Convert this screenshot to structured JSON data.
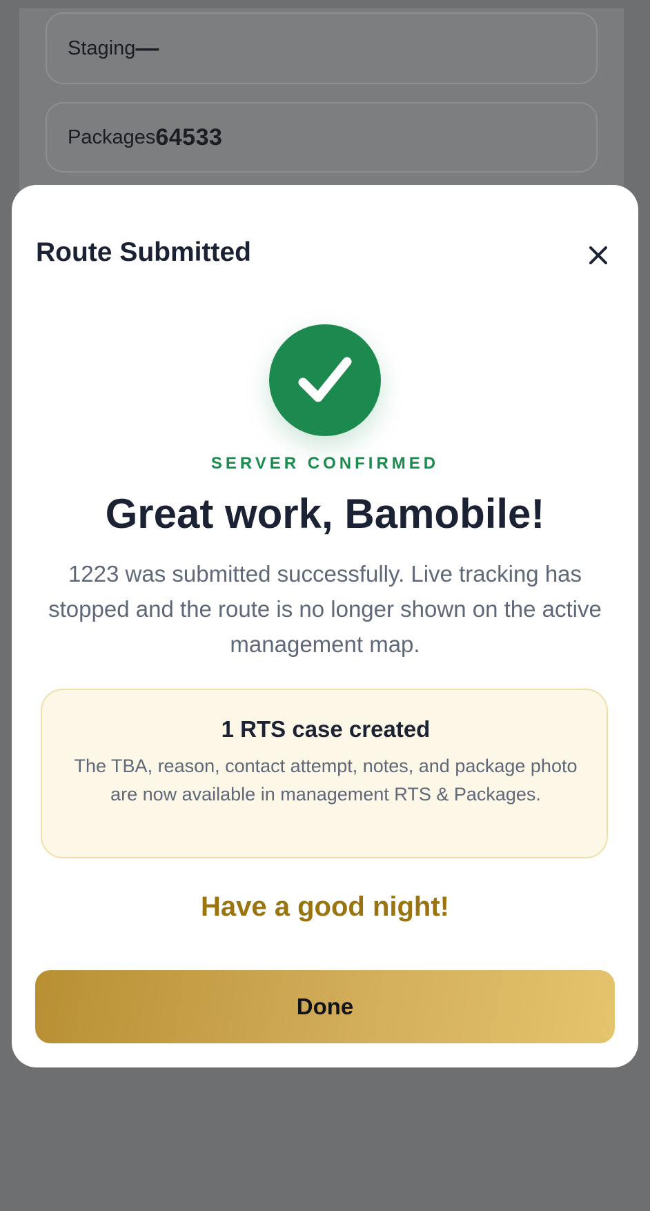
{
  "background": {
    "staging_label": "Staging",
    "staging_value": "—",
    "packages_label": "Packages",
    "packages_value": "64533"
  },
  "modal": {
    "title": "Route Submitted",
    "close_icon": "close-icon",
    "status_icon": "checkmark-icon",
    "status_label": "SERVER CONFIRMED",
    "headline": "Great work, Bamobile!",
    "message": "1223 was submitted successfully. Live tracking has stopped and the route is no longer shown on the active management map.",
    "rts": {
      "title": "1 RTS case created",
      "text": "The TBA, reason, contact attempt, notes, and package photo are now available in management RTS & Packages."
    },
    "farewell": "Have a good night!",
    "done_label": "Done"
  },
  "colors": {
    "success": "#1c8a4f",
    "accent_gold": "#9b7412",
    "button_gradient_start": "#b88f33",
    "button_gradient_end": "#e4c46c",
    "overlay": "#6e6f71"
  }
}
